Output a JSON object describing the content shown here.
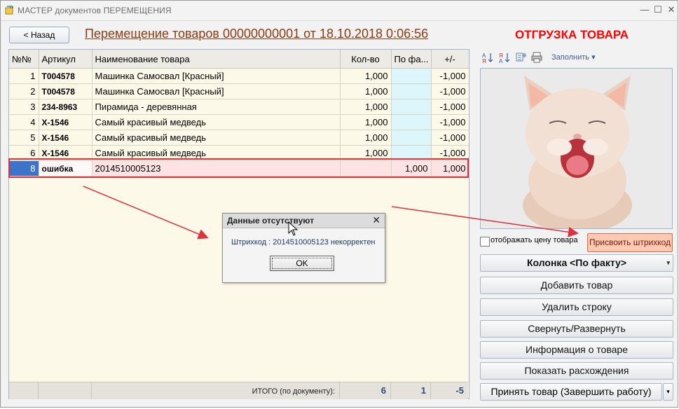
{
  "window": {
    "title": "МАСТЕР документов ПЕРЕМЕЩЕНИЯ",
    "close_glyph": "✕",
    "maximize_glyph": "☐",
    "minimize_glyph": "—"
  },
  "header": {
    "back_label": "< Назад",
    "doc_title": "Перемещение товаров 00000000001 от 18.10.2018 0:06:56",
    "status_title": "ОТГРУЗКА ТОВАРА"
  },
  "table": {
    "columns": [
      "№№",
      "Артикул",
      "Наименование товара",
      "Кол-во",
      "По фа...",
      "+/-"
    ],
    "rows": [
      {
        "num": "1",
        "art": "T004578",
        "name": "Машинка Самосвал [Красный]",
        "qty": "1,000",
        "fact": "",
        "diff": "-1,000"
      },
      {
        "num": "2",
        "art": "T004578",
        "name": "Машинка Самосвал [Красный]",
        "qty": "1,000",
        "fact": "",
        "diff": "-1,000"
      },
      {
        "num": "3",
        "art": "234-8963",
        "name": "Пирамида - деревянная",
        "qty": "1,000",
        "fact": "",
        "diff": "-1,000"
      },
      {
        "num": "4",
        "art": "X-1546",
        "name": "Самый красивый медведь",
        "qty": "1,000",
        "fact": "",
        "diff": "-1,000"
      },
      {
        "num": "5",
        "art": "X-1546",
        "name": "Самый красивый медведь",
        "qty": "1,000",
        "fact": "",
        "diff": "-1,000"
      },
      {
        "num": "6",
        "art": "X-1546",
        "name": "Самый красивый медведь",
        "qty": "1,000",
        "fact": "",
        "diff": "-1,000"
      },
      {
        "num": "8",
        "art": "ошибка",
        "name": "2014510005123",
        "qty": "",
        "fact": "1,000",
        "diff": "1,000"
      }
    ],
    "footer": {
      "label": "ИТОГО (по документу):",
      "qty_total": "6",
      "fact_total": "1",
      "diff_total": "-5"
    }
  },
  "toolbar": {
    "tools": [
      "sort-asc-icon",
      "sort-desc-icon",
      "settings-list-icon",
      "print-icon"
    ],
    "fill_label": "Заполнить"
  },
  "side": {
    "show_price_label": "отображать цену товара",
    "assign_barcode_label": "Присвоить штрихкод",
    "column_label": "Колонка <По факту>",
    "add_product_label": "Добавить товар",
    "delete_row_label": "Удалить строку",
    "collapse_label": "Свернуть/Развернуть",
    "info_label": "Информация о товаре",
    "diff_label": "Показать расхождения",
    "accept_label": "Принять товар (Завершить работу)"
  },
  "dialog": {
    "title": "Данные отсутствуют",
    "message": "Штрихкод : 2014510005123 некорректен",
    "ok_label": "OK"
  },
  "colors": {
    "accent_red": "#ff0000",
    "title_brown": "#8b3b12",
    "selected_blue": "#3d74c9",
    "fact_cyan": "#dcf6fb",
    "error_pink": "#fde3e3"
  }
}
